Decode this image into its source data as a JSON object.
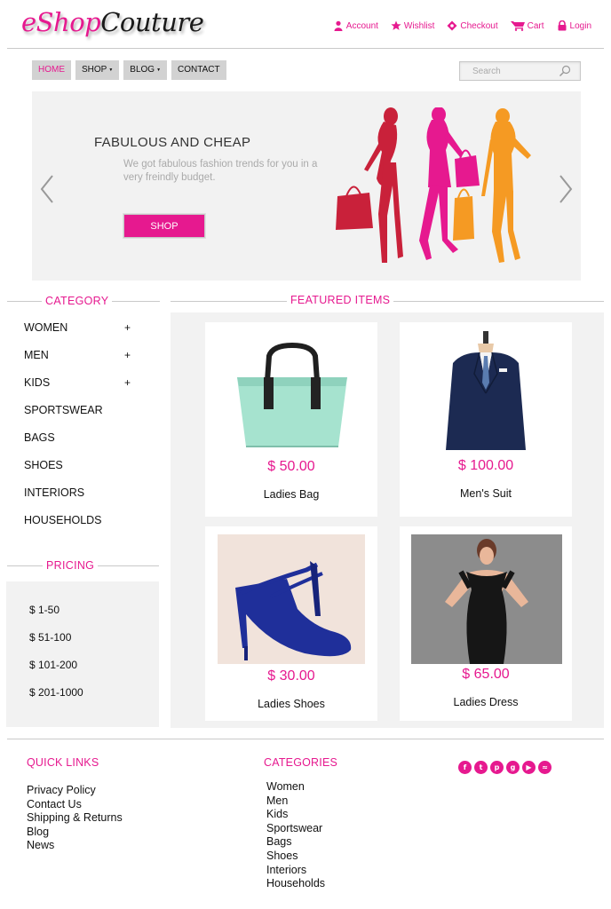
{
  "brand": {
    "logo_part1": "eShop",
    "logo_part2": "Couture",
    "accent": "#e6198f"
  },
  "top_links": [
    {
      "label": "Account",
      "icon": "user-icon"
    },
    {
      "label": "Wishlist",
      "icon": "star-icon"
    },
    {
      "label": "Checkout",
      "icon": "diamond-icon"
    },
    {
      "label": "Cart",
      "icon": "cart-icon"
    },
    {
      "label": "Login",
      "icon": "lock-icon"
    }
  ],
  "nav": {
    "home": "HOME",
    "shop": "SHOP",
    "blog": "BLOG",
    "contact": "CONTACT"
  },
  "search": {
    "placeholder": "Search"
  },
  "hero": {
    "title": "FABULOUS AND CHEAP",
    "text": "We got fabulous fashion trends for you in a very freindly budget.",
    "button": "SHOP"
  },
  "category": {
    "title": "CATEGORY",
    "items": [
      {
        "label": "WOMEN",
        "plus": "+"
      },
      {
        "label": "MEN",
        "plus": "+"
      },
      {
        "label": "KIDS",
        "plus": "+"
      },
      {
        "label": "SPORTSWEAR",
        "plus": ""
      },
      {
        "label": "BAGS",
        "plus": ""
      },
      {
        "label": "SHOES",
        "plus": ""
      },
      {
        "label": "INTERIORS",
        "plus": ""
      },
      {
        "label": "HOUSEHOLDS",
        "plus": ""
      }
    ]
  },
  "featured": {
    "title": "FEATURED ITEMS",
    "items": [
      {
        "price": "$ 50.00",
        "name": "Ladies Bag"
      },
      {
        "price": "$ 100.00",
        "name": "Men's Suit"
      },
      {
        "price": "$ 30.00",
        "name": "Ladies Shoes"
      },
      {
        "price": "$ 65.00",
        "name": "Ladies Dress"
      }
    ]
  },
  "pricing": {
    "title": "PRICING",
    "items": [
      "$ 1-50",
      "$ 51-100",
      "$ 101-200",
      "$ 201-1000"
    ]
  },
  "footer": {
    "quick_links_title": "QUICK LINKS",
    "quick_links": [
      "Privacy Policy",
      "Contact Us",
      "Shipping & Returns",
      "Blog",
      "News"
    ],
    "categories_title": "CATEGORIES",
    "categories": [
      "Women",
      "Men",
      "Kids",
      "Sportswear",
      "Bags",
      "Shoes",
      "Interiors",
      "Households"
    ],
    "social_icons": [
      "facebook-icon",
      "twitter-icon",
      "pinterest-icon",
      "google-plus-icon",
      "youtube-icon",
      "rss-icon"
    ]
  }
}
